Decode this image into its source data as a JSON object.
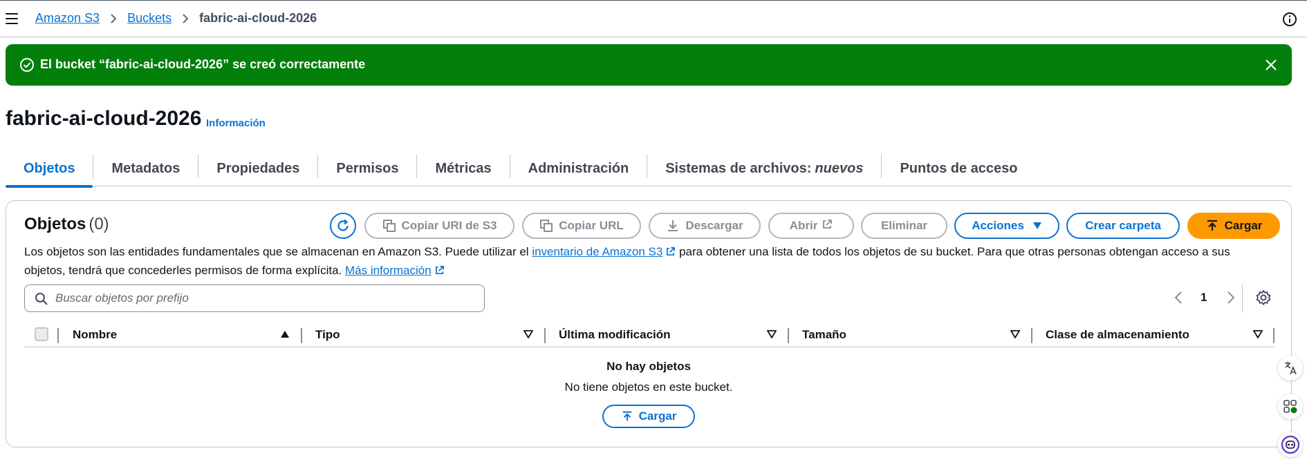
{
  "breadcrumb": {
    "items": [
      "Amazon S3",
      "Buckets"
    ],
    "current": "fabric-ai-cloud-2026"
  },
  "flash": {
    "message": "El bucket “fabric-ai-cloud-2026” se creó correctamente",
    "color": "#037f0c"
  },
  "page": {
    "title": "fabric-ai-cloud-2026",
    "info_link": "Información"
  },
  "tabs": [
    {
      "label": "Objetos",
      "active": true
    },
    {
      "label": "Metadatos"
    },
    {
      "label": "Propiedades"
    },
    {
      "label": "Permisos"
    },
    {
      "label": "Métricas"
    },
    {
      "label": "Administración"
    },
    {
      "label": "Sistemas de archivos:",
      "suffix": "nuevos"
    },
    {
      "label": "Puntos de acceso"
    }
  ],
  "objects": {
    "title": "Objetos",
    "count": "(0)",
    "buttons": {
      "copy_uri": "Copiar URI de S3",
      "copy_url": "Copiar URL",
      "download": "Descargar",
      "open": "Abrir",
      "delete": "Eliminar",
      "actions": "Acciones",
      "create_folder": "Crear carpeta",
      "upload": "Cargar"
    },
    "description": {
      "part1": "Los objetos son las entidades fundamentales que se almacenan en Amazon S3. Puede utilizar el ",
      "link1": "inventario de Amazon S3",
      "part2": " para obtener una lista de todos los objetos de su bucket. Para que otras personas obtengan acceso a sus objetos, tendrá que concederles permisos de forma explícita. ",
      "link2": "Más información"
    },
    "search_placeholder": "Buscar objetos por prefijo",
    "page_number": "1",
    "columns": [
      "Nombre",
      "Tipo",
      "Última modificación",
      "Tamaño",
      "Clase de almacenamiento"
    ],
    "empty": {
      "title": "No hay objetos",
      "subtitle": "No tiene objetos en este bucket.",
      "button": "Cargar"
    }
  },
  "colors": {
    "accent": "#0972d3",
    "primary_button": "#ff9900",
    "success": "#037f0c"
  }
}
